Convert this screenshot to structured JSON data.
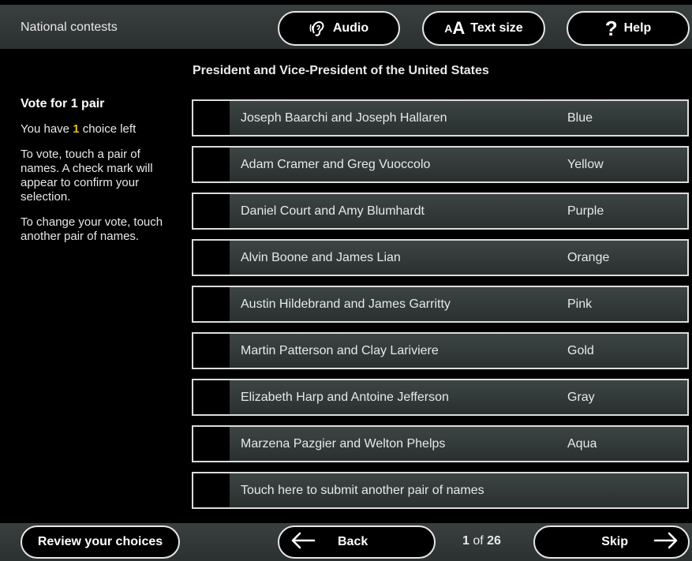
{
  "header": {
    "section_label": "National contests",
    "audio_label": "Audio",
    "text_size_small": "A",
    "text_size_big": "A",
    "text_size_label": "Text size",
    "help_mark": "?",
    "help_label": "Help"
  },
  "contest": {
    "title": "President and Vice-President of the United States"
  },
  "instructions": {
    "vote_for": "Vote for 1 pair",
    "choices_prefix": "You have ",
    "choices_count": "1",
    "choices_suffix": " choice left",
    "how_to_vote": "To vote, touch a pair of names. A check mark will appear to confirm your selection.",
    "how_to_change": "To change your vote, touch another pair of names."
  },
  "candidates": [
    {
      "name": "Joseph Baarchi and Joseph Hallaren",
      "party": "Blue"
    },
    {
      "name": "Adam Cramer and Greg Vuoccolo",
      "party": "Yellow"
    },
    {
      "name": "Daniel Court and Amy Blumhardt",
      "party": "Purple"
    },
    {
      "name": "Alvin Boone and James Lian",
      "party": "Orange"
    },
    {
      "name": "Austin Hildebrand and James Garritty",
      "party": "Pink"
    },
    {
      "name": "Martin Patterson and Clay Lariviere",
      "party": "Gold"
    },
    {
      "name": "Elizabeth Harp and Antoine Jefferson",
      "party": "Gray"
    },
    {
      "name": "Marzena Pazgier and Welton Phelps",
      "party": "Aqua"
    },
    {
      "name": "Touch here to submit another pair of names",
      "party": ""
    }
  ],
  "footer": {
    "review_label": "Review your choices",
    "back_label": "Back",
    "page_current": "1",
    "page_of": " of ",
    "page_total": "26",
    "skip_label": "Skip"
  },
  "colors": {
    "background": "#000000",
    "bar": "#333838",
    "accent_count": "#f0b81a"
  },
  "icons": [
    "audio-hearing-icon",
    "text-size-icon",
    "help-question-icon",
    "arrow-left-icon",
    "arrow-right-icon"
  ]
}
